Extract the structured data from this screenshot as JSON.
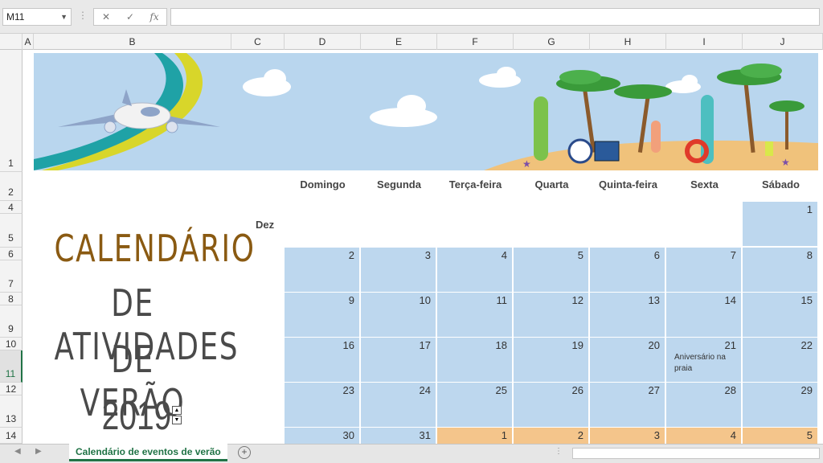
{
  "formula_bar": {
    "name_box": "M11",
    "cancel": "✕",
    "enter": "✓",
    "fx": "fx",
    "value": ""
  },
  "columns": [
    "A",
    "B",
    "C",
    "D",
    "E",
    "F",
    "G",
    "H",
    "I",
    "J"
  ],
  "rows": [
    "1",
    "2",
    "4",
    "5",
    "6",
    "7",
    "8",
    "9",
    "10",
    "11",
    "12",
    "13",
    "14"
  ],
  "title": {
    "line1": "CALENDÁRIO",
    "line2": "DE ATIVIDADES",
    "line3": "DE VERÃO",
    "year": "2019"
  },
  "month_label": "Dez",
  "weekdays": [
    "Domingo",
    "Segunda",
    "Terça-feira",
    "Quarta",
    "Quinta-feira",
    "Sexta",
    "Sábado"
  ],
  "weeks": [
    [
      null,
      null,
      null,
      null,
      null,
      null,
      "1"
    ],
    [
      "2",
      "3",
      "4",
      "5",
      "6",
      "7",
      "8"
    ],
    [
      "9",
      "10",
      "11",
      "12",
      "13",
      "14",
      "15"
    ],
    [
      "16",
      "17",
      "18",
      "19",
      "20",
      "21",
      "22"
    ],
    [
      "23",
      "24",
      "25",
      "26",
      "27",
      "28",
      "29"
    ],
    [
      "30",
      "31",
      "1",
      "2",
      "3",
      "4",
      "5"
    ]
  ],
  "events": {
    "21": "Aniversário na praia"
  },
  "sheet_tab": "Calendário de eventos de verão",
  "colors": {
    "cell_blue": "#bdd7ee",
    "cell_orange": "#f4c58b",
    "title_brown": "#8a5a12",
    "title_gray": "#4a4a4a",
    "excel_green": "#217346"
  }
}
